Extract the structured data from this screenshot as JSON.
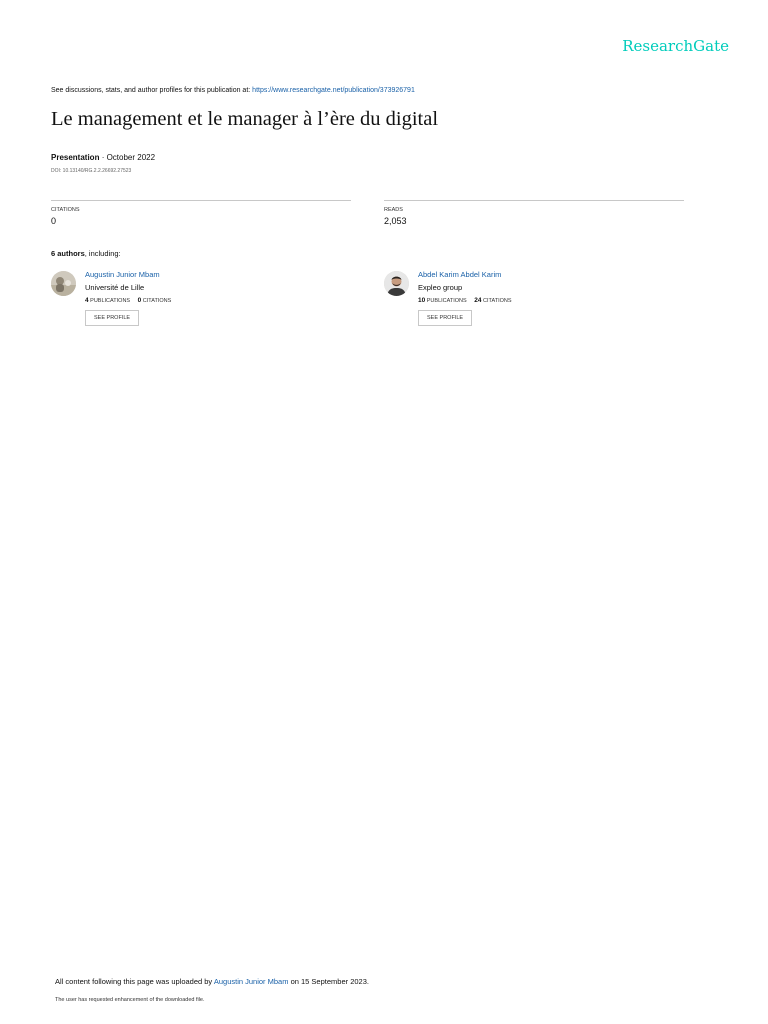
{
  "header": {
    "logo_text": "ResearchGate",
    "logo_color": "#00ccbb"
  },
  "discussion": {
    "prefix": "See discussions, stats, and author profiles for this publication at: ",
    "url": "https://www.researchgate.net/publication/373926791"
  },
  "publication": {
    "title": "Le management et le manager à l’ère du digital",
    "type": "Presentation",
    "date": " · October 2022",
    "doi": "DOI: 10.13140/RG.2.2.26692.27523"
  },
  "stats": {
    "citations_label": "CITATIONS",
    "citations_value": "0",
    "reads_label": "READS",
    "reads_value": "2,053"
  },
  "authors_line": {
    "count": "6 authors",
    "suffix": ", including:"
  },
  "authors": [
    {
      "name": "Augustin Junior Mbam",
      "institution": "Université de Lille",
      "publications_count": "4",
      "publications_label": "PUBLICATIONS",
      "citations_count": "0",
      "citations_label": "CITATIONS",
      "profile_button": "SEE PROFILE"
    },
    {
      "name": "Abdel Karim Abdel Karim",
      "institution": "Expleo group",
      "publications_count": "10",
      "publications_label": "PUBLICATIONS",
      "citations_count": "24",
      "citations_label": "CITATIONS",
      "profile_button": "SEE PROFILE"
    }
  ],
  "footer": {
    "upload_prefix": "All content following this page was uploaded by ",
    "uploader": "Augustin Junior Mbam",
    "upload_suffix": " on 15 September 2023.",
    "note": "The user has requested enhancement of the downloaded file."
  },
  "colors": {
    "link": "#1a61a8",
    "divider": "#c8c8c8"
  }
}
